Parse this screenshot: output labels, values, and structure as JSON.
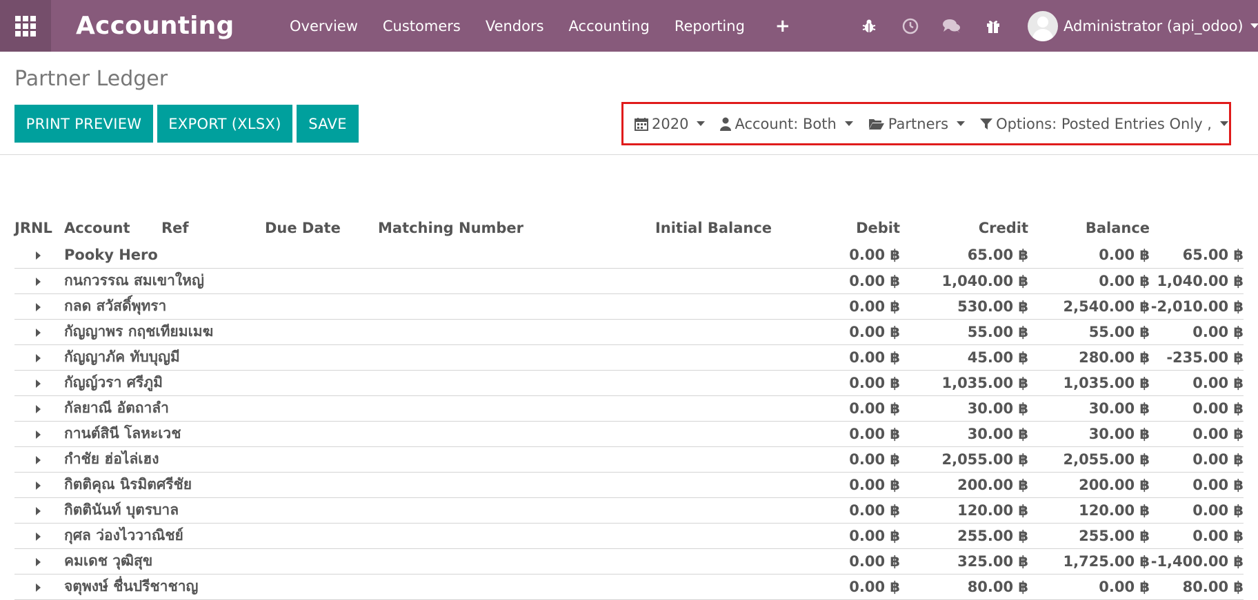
{
  "navbar": {
    "brand": "Accounting",
    "menu": [
      "Overview",
      "Customers",
      "Vendors",
      "Accounting",
      "Reporting"
    ],
    "plus": "+",
    "tray_icons": [
      "bug-icon",
      "clock-icon",
      "chat-icon",
      "gift-icon"
    ],
    "user": "Administrator (api_odoo)"
  },
  "page": {
    "title": "Partner Ledger",
    "buttons": {
      "print": "PRINT PREVIEW",
      "export": "EXPORT (XLSX)",
      "save": "SAVE"
    },
    "filters": {
      "date": "2020",
      "account": "Account: Both",
      "partners": "Partners",
      "options": "Options: Posted Entries Only ,"
    }
  },
  "table": {
    "headers": {
      "jrnl": "JRNL",
      "account": "Account",
      "ref": "Ref",
      "due_date": "Due Date",
      "matching": "Matching Number",
      "initial": "Initial Balance",
      "debit": "Debit",
      "credit": "Credit",
      "balance": "Balance"
    },
    "rows": [
      [
        "Pooky Hero",
        "0.00 ฿",
        "65.00 ฿",
        "0.00 ฿",
        "65.00 ฿"
      ],
      [
        "กนกวรรณ สมเขาใหญ่",
        "0.00 ฿",
        "1,040.00 ฿",
        "0.00 ฿",
        "1,040.00 ฿"
      ],
      [
        "กลด สวัสดิ์พุทรา",
        "0.00 ฿",
        "530.00 ฿",
        "2,540.00 ฿",
        "-2,010.00 ฿"
      ],
      [
        "กัญญาพร กฤชเทียมเมฆ",
        "0.00 ฿",
        "55.00 ฿",
        "55.00 ฿",
        "0.00 ฿"
      ],
      [
        "กัญญาภัค ทับบุญมี",
        "0.00 ฿",
        "45.00 ฿",
        "280.00 ฿",
        "-235.00 ฿"
      ],
      [
        "กัญญ์วรา ศรีภูมิ",
        "0.00 ฿",
        "1,035.00 ฿",
        "1,035.00 ฿",
        "0.00 ฿"
      ],
      [
        "กัลยาณี อัตถาลำ",
        "0.00 ฿",
        "30.00 ฿",
        "30.00 ฿",
        "0.00 ฿"
      ],
      [
        "กานต์สินี โลหะเวช",
        "0.00 ฿",
        "30.00 ฿",
        "30.00 ฿",
        "0.00 ฿"
      ],
      [
        "กำชัย ฮ่อไล่เฮง",
        "0.00 ฿",
        "2,055.00 ฿",
        "2,055.00 ฿",
        "0.00 ฿"
      ],
      [
        "กิตติคุณ นิรมิตศรีชัย",
        "0.00 ฿",
        "200.00 ฿",
        "200.00 ฿",
        "0.00 ฿"
      ],
      [
        "กิตตินันท์ บุตรบาล",
        "0.00 ฿",
        "120.00 ฿",
        "120.00 ฿",
        "0.00 ฿"
      ],
      [
        "กุศล ว่องไววาณิชย์",
        "0.00 ฿",
        "255.00 ฿",
        "255.00 ฿",
        "0.00 ฿"
      ],
      [
        "คมเดช วุฒิสุข",
        "0.00 ฿",
        "325.00 ฿",
        "1,725.00 ฿",
        "-1,400.00 ฿"
      ],
      [
        "จตุพงษ์ ชื่นปรีชาชาญ",
        "0.00 ฿",
        "80.00 ฿",
        "0.00 ฿",
        "80.00 ฿"
      ]
    ]
  },
  "colors": {
    "navbar": "#875a7b",
    "button": "#00a09d",
    "highlight_border": "#e01b1b"
  }
}
